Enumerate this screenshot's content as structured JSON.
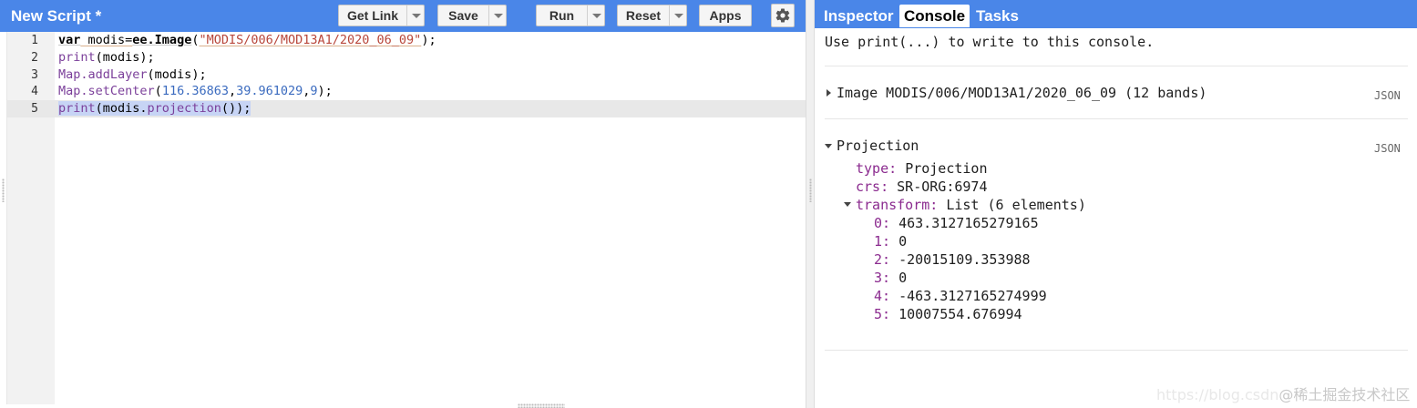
{
  "editor": {
    "title": "New Script *",
    "toolbar": {
      "get_link": "Get Link",
      "save": "Save",
      "run": "Run",
      "reset": "Reset",
      "apps": "Apps",
      "settings_icon": "gear-icon"
    },
    "line_numbers": [
      "1",
      "2",
      "3",
      "4",
      "5"
    ],
    "code": {
      "line1": {
        "kw": "var",
        "ident": " modis=",
        "obj": "ee.Image",
        "open": "(",
        "str": "\"MODIS/006/MOD13A1/2020_06_09\"",
        "close": ");"
      },
      "line2": {
        "fn": "print",
        "rest": "(modis);"
      },
      "line3": {
        "fn": "Map.addLayer",
        "rest": "(modis);"
      },
      "line4": {
        "fn": "Map.setCenter",
        "open": "(",
        "n1": "116.36863",
        "c1": ",",
        "n2": "39.961029",
        "c2": ",",
        "n3": "9",
        "close": ");"
      },
      "line5": {
        "fn": "print",
        "rest": "(modis.",
        "fn2": "projection",
        "close": "());"
      }
    }
  },
  "console": {
    "tabs": [
      "Inspector",
      "Console",
      "Tasks"
    ],
    "active_tab": "Console",
    "hint": "Use print(...) to write to this console.",
    "image_entry": {
      "text": "Image MODIS/006/MOD13A1/2020_06_09 (12 bands)",
      "json_link": "JSON",
      "expanded": false
    },
    "projection_entry": {
      "title": "Projection",
      "json_link": "JSON",
      "expanded": true,
      "type_key": "type:",
      "type_value": "Projection",
      "crs_key": "crs:",
      "crs_value": "SR-ORG:6974",
      "transform_key": "transform:",
      "transform_value": "List (6 elements)",
      "transform_items": [
        {
          "key": "0:",
          "value": "463.3127165279165"
        },
        {
          "key": "1:",
          "value": "0"
        },
        {
          "key": "2:",
          "value": "-20015109.353988"
        },
        {
          "key": "3:",
          "value": "0"
        },
        {
          "key": "4:",
          "value": "-463.3127165274999"
        },
        {
          "key": "5:",
          "value": "10007554.676994"
        }
      ]
    }
  },
  "watermark": {
    "faint": "https://blog.csdn",
    "text": "@稀土掘金技术社区"
  },
  "colors": {
    "header_blue": "#4a86e8",
    "key_purple": "#8b2b8f",
    "string_red": "#b8463a",
    "number_blue": "#3b6bbf"
  }
}
